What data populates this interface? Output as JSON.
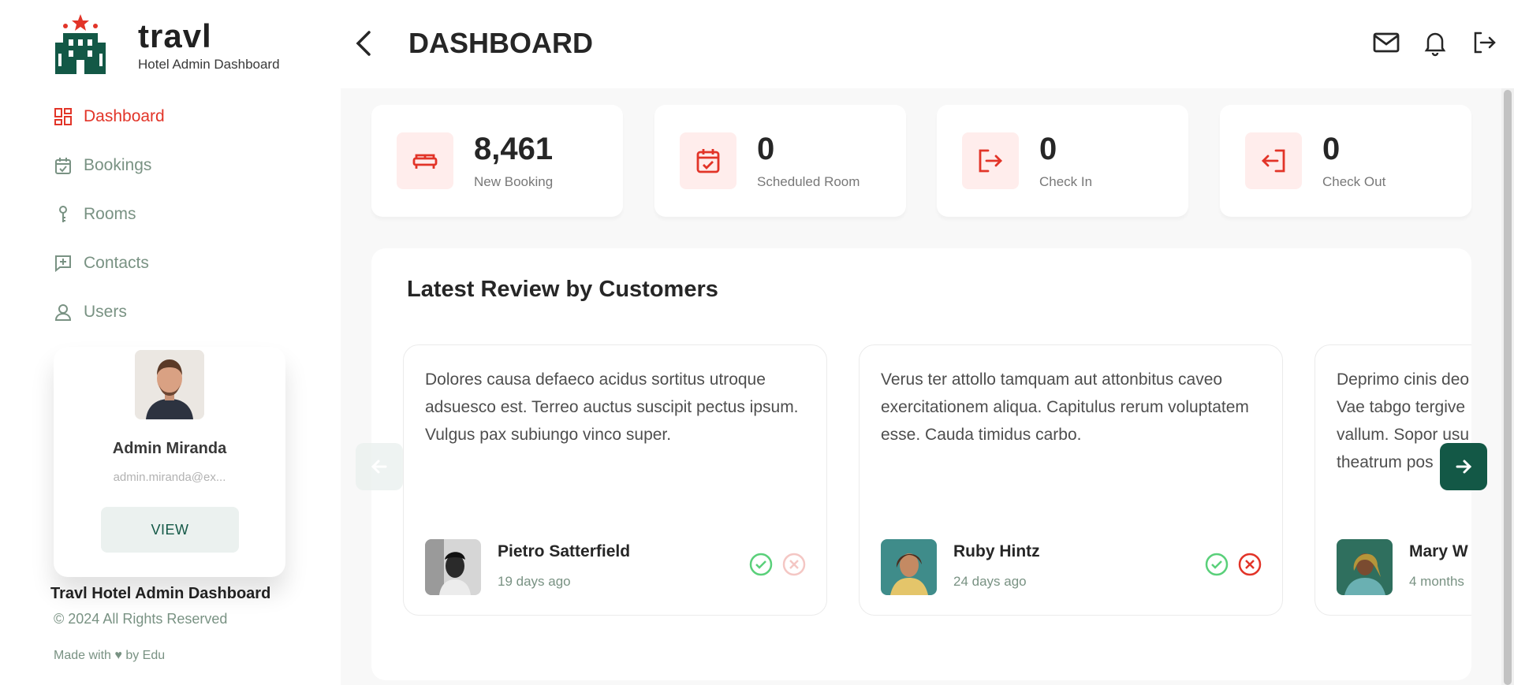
{
  "brand": {
    "title": "travl",
    "subtitle": "Hotel Admin Dashboard",
    "colors": {
      "primary": "#135846",
      "accent": "#e23428",
      "muted": "#799283"
    }
  },
  "sidebar": {
    "items": [
      {
        "label": "Dashboard",
        "icon": "dashboard-grid-icon",
        "active": true
      },
      {
        "label": "Bookings",
        "icon": "calendar-check-icon",
        "active": false
      },
      {
        "label": "Rooms",
        "icon": "key-icon",
        "active": false
      },
      {
        "label": "Contacts",
        "icon": "message-plus-icon",
        "active": false
      },
      {
        "label": "Users",
        "icon": "user-icon",
        "active": false
      }
    ]
  },
  "profile": {
    "name": "Admin Miranda",
    "email": "admin.miranda@ex...",
    "view_label": "VIEW"
  },
  "footer": {
    "title": "Travl Hotel Admin Dashboard",
    "copyright": "© 2024 All Rights Reserved",
    "made_with": "Made with ♥ by Edu"
  },
  "header": {
    "title": "DASHBOARD",
    "icons": [
      "mail-icon",
      "bell-icon",
      "logout-icon"
    ]
  },
  "kpis": [
    {
      "value": "8,461",
      "label": "New Booking",
      "icon": "bed-icon"
    },
    {
      "value": "0",
      "label": "Scheduled Room",
      "icon": "calendar-check-icon"
    },
    {
      "value": "0",
      "label": "Check In",
      "icon": "check-in-icon"
    },
    {
      "value": "0",
      "label": "Check Out",
      "icon": "check-out-icon"
    }
  ],
  "reviews": {
    "title": "Latest Review by Customers",
    "items": [
      {
        "text": "Dolores causa defaeco acidus sortitus utroque adsuesco est. Terreo auctus suscipit pectus ipsum. Vulgus pax subiungo vinco super.",
        "name": "Pietro Satterfield",
        "time": "19 days ago"
      },
      {
        "text": "Verus ter attollo tamquam aut attonbitus caveo exercitationem aliqua. Capitulus rerum voluptatem esse. Cauda timidus carbo.",
        "name": "Ruby Hintz",
        "time": "24 days ago"
      },
      {
        "text": "Deprimo cinis deo Vae tabgo tergive vallum. Sopor usu theatrum pos",
        "name": "Mary W",
        "time": "4 months"
      }
    ]
  }
}
